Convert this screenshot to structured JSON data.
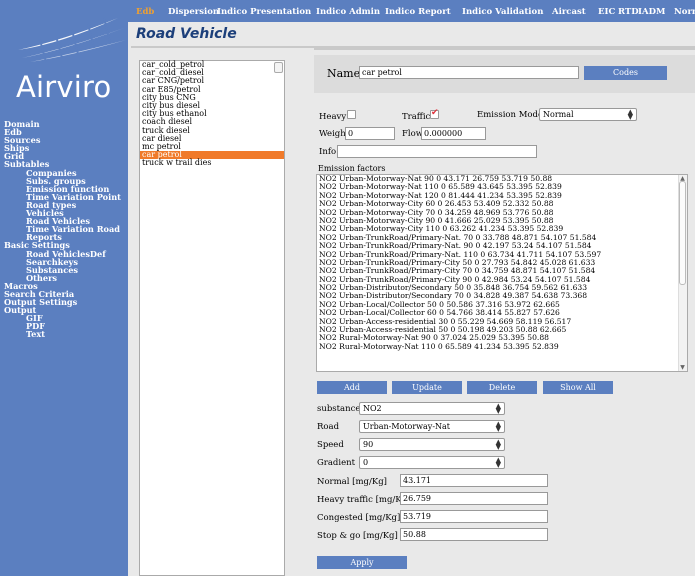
{
  "app": {
    "logo_text": "Airviro",
    "page_title": "Road Vehicle"
  },
  "menu": {
    "items": [
      "Edb",
      "Dispersion",
      "Indico Presentation",
      "Indico Admin",
      "Indico Report",
      "Indico Validation",
      "Aircast",
      "EIC",
      "RTD",
      "IADM",
      "Normet"
    ],
    "active": "Edb"
  },
  "sidebar": {
    "items": [
      {
        "label": "Domain",
        "level": 0
      },
      {
        "label": "Edb",
        "level": 0
      },
      {
        "label": "Sources",
        "level": 0
      },
      {
        "label": "Ships",
        "level": 0
      },
      {
        "label": "Grid",
        "level": 0
      },
      {
        "label": "Subtables",
        "level": 0
      },
      {
        "label": "Companies",
        "level": 1
      },
      {
        "label": "Subs. groups",
        "level": 1
      },
      {
        "label": "Emission function",
        "level": 1
      },
      {
        "label": "Time Variation Point",
        "level": 1
      },
      {
        "label": "Road types",
        "level": 1
      },
      {
        "label": "Vehicles",
        "level": 1
      },
      {
        "label": "Road Vehicles",
        "level": 1
      },
      {
        "label": "Time Variation Road",
        "level": 1
      },
      {
        "label": "Reports",
        "level": 1
      },
      {
        "label": "Basic Settings",
        "level": 0
      },
      {
        "label": "Road VehiclesDef",
        "level": 1
      },
      {
        "label": "Searchkeys",
        "level": 1
      },
      {
        "label": "Substances",
        "level": 1
      },
      {
        "label": "Others",
        "level": 1
      },
      {
        "label": "Macros",
        "level": 0
      },
      {
        "label": "Search Criteria",
        "level": 0
      },
      {
        "label": "Output Settings",
        "level": 0
      },
      {
        "label": "Output",
        "level": 0
      },
      {
        "label": "GIF",
        "level": 1
      },
      {
        "label": "PDF",
        "level": 1
      },
      {
        "label": "Text",
        "level": 1
      }
    ]
  },
  "vehicles": {
    "items": [
      "car_cold_petrol",
      "car_cold_diesel",
      "car CNG/petrol",
      "car E85/petrol",
      "city bus CNG",
      "city bus diesel",
      "city bus ethanol",
      "coach diesel",
      "truck diesel",
      "car diesel",
      "mc petrol",
      "car petrol",
      "truck w trail dies"
    ],
    "selected": "car petrol"
  },
  "form": {
    "name_label": "Name",
    "name_value": "car petrol",
    "codes_label": "Codes",
    "heavy_label": "Heavy",
    "heavy_checked": false,
    "traffic_label": "Traffic",
    "traffic_checked": true,
    "emission_model_label": "Emission Model",
    "emission_model_value": "Normal",
    "weight_label": "Weight",
    "weight_value": "0",
    "flow_label": "Flow",
    "flow_value": "0.000000",
    "info_label": "Info",
    "info_value": "",
    "ef_label": "Emission factors"
  },
  "emission_factors": [
    "NO2 Urban-Motorway-Nat 90 0 43.171 26.759 53.719 50.88",
    "NO2 Urban-Motorway-Nat 110 0 65.589 43.645 53.395 52.839",
    "NO2 Urban-Motorway-Nat 120 0 81.444 41.234 53.395 52.839",
    "NO2 Urban-Motorway-City 60 0 26.453 53.409 52.332 50.88",
    "NO2 Urban-Motorway-City 70 0 34.259 48.969 53.776 50.88",
    "NO2 Urban-Motorway-City 90 0 41.666 25.029 53.395 50.88",
    "NO2 Urban-Motorway-City 110 0 63.262 41.234 53.395 52.839",
    "NO2 Urban-TrunkRoad/Primary-Nat. 70 0 33.788 48.871 54.107 51.584",
    "NO2 Urban-TrunkRoad/Primary-Nat. 90 0 42.197 53.24 54.107 51.584",
    "NO2 Urban-TrunkRoad/Primary-Nat. 110 0 63.734 41.711 54.107 53.597",
    "NO2 Urban-TrunkRoad/Primary-City 50 0 27.793 54.842 45.028 61.633",
    "NO2 Urban-TrunkRoad/Primary-City 70 0 34.759 48.871 54.107 51.584",
    "NO2 Urban-TrunkRoad/Primary-City 90 0 42.984 53.24 54.107 51.584",
    "NO2 Urban-Distributor/Secondary 50 0 35.848 36.754 59.562 61.633",
    "NO2 Urban-Distributor/Secondary 70 0 34.828 49.387 54.638 73.368",
    "NO2 Urban-Local/Collector 50 0 50.586 37.316 53.972 62.665",
    "NO2 Urban-Local/Collector 60 0 54.766 38.414 55.827 57.626",
    "NO2 Urban-Access-residential 30 0 55.229 54.669 58.119 56.517",
    "NO2 Urban-Access-residential 50 0 50.198 49.203 50.88 62.665",
    "NO2 Rural-Motorway-Nat 90 0 37.024 25.029 53.395 50.88",
    "NO2 Rural-Motorway-Nat 110 0 65.589 41.234 53.395 52.839"
  ],
  "ef_buttons": {
    "add": "Add",
    "update": "Update",
    "delete": "Delete",
    "show_all": "Show All"
  },
  "detail": {
    "substance_label": "substance",
    "substance_value": "NO2",
    "road_label": "Road",
    "road_value": "Urban-Motorway-Nat",
    "speed_label": "Speed",
    "speed_value": "90",
    "gradient_label": "Gradient",
    "gradient_value": "0",
    "normal_label": "Normal [mg/Kg]",
    "normal_value": "43.171",
    "heavy_traffic_label": "Heavy traffic [mg/Kg]",
    "heavy_traffic_value": "26.759",
    "congested_label": "Congested [mg/Kg]",
    "congested_value": "53.719",
    "stopgo_label": "Stop & go [mg/Kg]",
    "stopgo_value": "50.88",
    "apply_label": "Apply"
  },
  "colors": {
    "sidebar_bg": "#5b7fc0",
    "selected_row": "#f07a2a",
    "title": "#1c3f7a",
    "active_menu": "#f0a030",
    "check_mark": "#e0303a"
  }
}
